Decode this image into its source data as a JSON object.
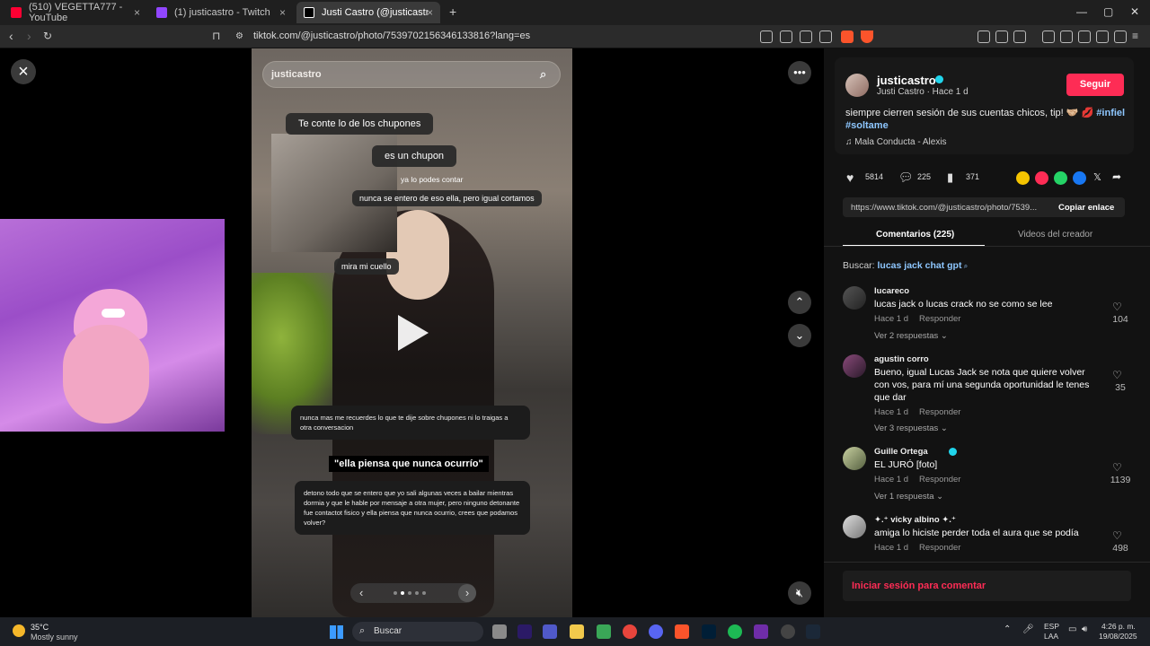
{
  "browser": {
    "tabs": [
      {
        "title": "(510) VEGETTA777 - YouTube",
        "color": "#ff0033"
      },
      {
        "title": "(1) justicastro - Twitch",
        "color": "#9146ff"
      },
      {
        "title": "Justi Castro (@justicastro) | TikTok",
        "color": "#ffffff"
      }
    ],
    "new_tab_label": "+",
    "url": "tiktok.com/@justicastro/photo/7539702156346133816?lang=es"
  },
  "photo": {
    "search_text": "justicastro",
    "bubbles": {
      "b1": "Te conte lo de los chupones",
      "b2": "es un chupon",
      "b3": "ya lo podes contar",
      "b4": "nunca se entero de eso ella, pero igual cortamos",
      "b5": "mira mi cuello"
    },
    "message1": "nunca mas me recuerdes lo que te dije sobre chupones ni lo traigas a otra conversacion",
    "quote": "\"ella piensa que nunca ocurrío\"",
    "message2": "detono todo que se entero que yo sali algunas veces a bailar mientras dormia y que le hable por mensaje a otra mujer, pero ninguno detonante fue contactot fisico y ella piensa que nunca ocurrio, crees que podamos volver?"
  },
  "creator": {
    "username": "justicastro",
    "subtitle": "Justi Castro · Hace 1 d",
    "follow_label": "Seguir",
    "caption_text": "siempre cierren sesión de sus cuentas chicos, tip! 🤝🏼 💋 ",
    "tag1": "#infiel",
    "tag2": "#soltame",
    "music": "Mala Conducta - Alexis"
  },
  "stats": {
    "likes": "5814",
    "comments": "225",
    "saves": "371"
  },
  "share": {
    "link": "https://www.tiktok.com/@justicastro/photo/7539...",
    "copy_label": "Copiar enlace"
  },
  "tabs": {
    "comments": "Comentarios (225)",
    "creator_videos": "Videos del creador"
  },
  "search": {
    "label": "Buscar: ",
    "term": "lucas jack chat gpt"
  },
  "comments": [
    {
      "user": "lucareco",
      "text": "lucas jack o lucas crack no se como se lee",
      "time": "Hace 1 d",
      "reply": "Responder",
      "replies": "Ver 2 respuestas ⌄",
      "likes": "104"
    },
    {
      "user": "agustin corro",
      "text": "Bueno, igual Lucas Jack se nota que quiere volver con vos, para mí una segunda oportunidad le tenes que dar",
      "time": "Hace 1 d",
      "reply": "Responder",
      "replies": "Ver 3 respuestas ⌄",
      "likes": "35"
    },
    {
      "user": "Guille Ortega",
      "text": "EL JURÓ [foto]",
      "time": "Hace 1 d",
      "reply": "Responder",
      "replies": "Ver 1 respuesta ⌄",
      "likes": "1139"
    },
    {
      "user": "✦.⁺ vicky albino ✦.⁺",
      "text": "amiga lo hiciste perder toda el aura que se podía",
      "time": "Hace 1 d",
      "reply": "Responder",
      "likes": "498"
    }
  ],
  "login_prompt": "Iniciar sesión para comentar",
  "taskbar": {
    "weather_temp": "35°C",
    "weather_desc": "Mostly sunny",
    "search": "Buscar",
    "lang1": "ESP",
    "lang2": "LAA",
    "time": "4:26 p. m.",
    "date": "19/08/2025"
  },
  "colors": {
    "accent": "#fe2c55",
    "link": "#8ec7ff",
    "panel": "#121212"
  }
}
